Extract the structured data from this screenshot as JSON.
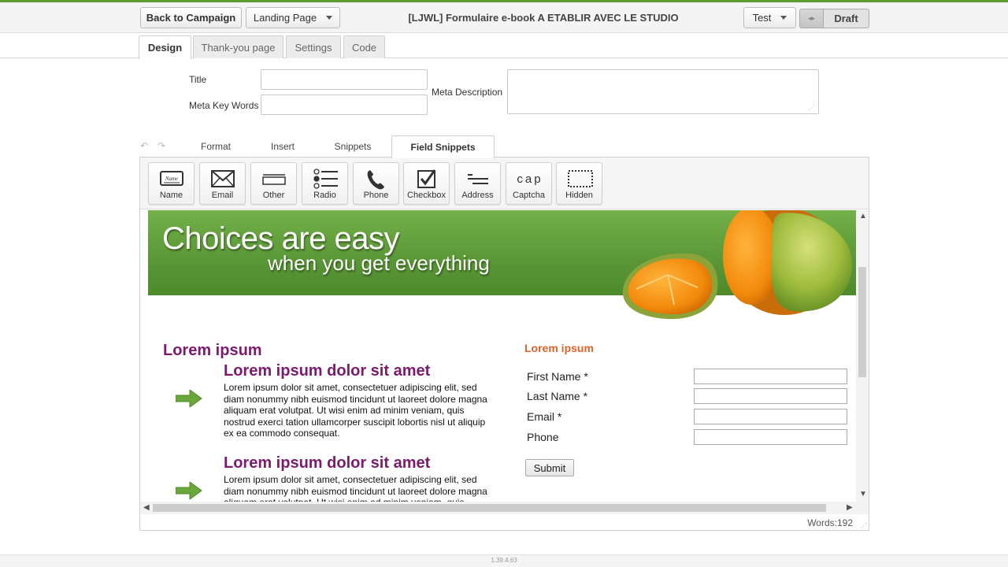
{
  "header": {
    "back_label": "Back to Campaign",
    "page_type": "Landing Page",
    "title": "[LJWL] Formulaire e-book A ETABLIR AVEC LE STUDIO",
    "test_label": "Test",
    "toggle_arrows": "◂▸",
    "status_label": "Draft"
  },
  "tabs": [
    "Design",
    "Thank-you page",
    "Settings",
    "Code"
  ],
  "meta": {
    "title_label": "Title",
    "title_value": "",
    "keywords_label": "Meta Key Words",
    "keywords_value": "",
    "description_label": "Meta Description",
    "description_value": ""
  },
  "editor_tabs": [
    "Format",
    "Insert",
    "Snippets",
    "Field Snippets"
  ],
  "field_snippets": [
    {
      "label": "Name",
      "icon": "name-icon"
    },
    {
      "label": "Email",
      "icon": "envelope-icon"
    },
    {
      "label": "Other",
      "icon": "textbox-icon"
    },
    {
      "label": "Radio",
      "icon": "radio-list-icon"
    },
    {
      "label": "Phone",
      "icon": "phone-icon"
    },
    {
      "label": "Checkbox",
      "icon": "checkbox-icon"
    },
    {
      "label": "Address",
      "icon": "address-icon"
    },
    {
      "label": "Captcha",
      "icon": "captcha-icon"
    },
    {
      "label": "Hidden",
      "icon": "hidden-field-icon"
    }
  ],
  "icon_text": {
    "name": "Name",
    "captcha": "cap"
  },
  "banner": {
    "headline": "Choices are easy",
    "subheadline": "when you get everything"
  },
  "content": {
    "left_title": "Lorem ipsum",
    "features": [
      {
        "title": "Lorem ipsum dolor sit amet",
        "text": "Lorem ipsum dolor sit amet, consectetuer adipiscing elit, sed diam nonummy nibh euismod tincidunt ut laoreet dolore magna aliquam erat volutpat. Ut wisi enim ad minim veniam, quis nostrud exerci tation ullamcorper suscipit lobortis nisl ut aliquip ex ea commodo consequat."
      },
      {
        "title": "Lorem ipsum dolor sit amet",
        "text": "Lorem ipsum dolor sit amet, consectetuer adipiscing elit, sed diam nonummy nibh euismod tincidunt ut laoreet dolore magna aliquam erat volutpat. Ut wisi enim ad minim veniam, quis"
      }
    ],
    "form_title": "Lorem ipsum",
    "form_fields": [
      {
        "label": "First Name *",
        "value": ""
      },
      {
        "label": "Last Name *",
        "value": ""
      },
      {
        "label": "Email *",
        "value": ""
      },
      {
        "label": "Phone",
        "value": ""
      }
    ],
    "submit_label": "Submit"
  },
  "footer": {
    "words": "Words:192",
    "version": "1.39.4.63"
  },
  "colors": {
    "brand_green": "#5a9a2e",
    "heading_purple": "#7b1a6f",
    "form_title_orange": "#e0602a"
  }
}
